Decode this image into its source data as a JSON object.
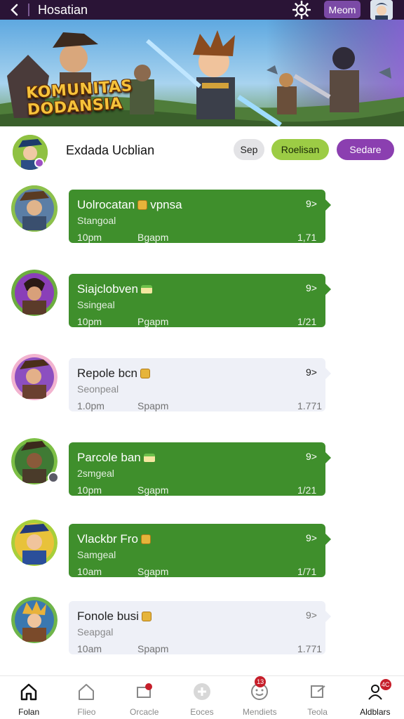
{
  "app": {
    "title": "Hosatian",
    "menu_button_label": "Meom"
  },
  "banner": {
    "title": "KOMUNITAS DODANSIA"
  },
  "header": {
    "name": "Exdada Ucblian",
    "buttons": [
      "Sep",
      "Roelisan",
      "Sedare"
    ],
    "colors": {
      "sep": "#e3e3e6",
      "roelisan": "#9ccc45",
      "sedare": "#8b3fb0"
    }
  },
  "messages": [
    {
      "name": "Uolrocatan",
      "suffix": "vpnsa",
      "emoji": "coin",
      "count": "9>",
      "subtitle": "Stangoal",
      "time": "10pm",
      "tag": "Bgapm",
      "number": "1,71",
      "style": "green"
    },
    {
      "name": "Siajclobven",
      "suffix": "",
      "emoji": "cake",
      "count": "9>",
      "subtitle": "Ssingeal",
      "time": "10pm",
      "tag": "Pgapm",
      "number": "1/21",
      "style": "green"
    },
    {
      "name": "Repole bcn",
      "suffix": "",
      "emoji": "coin",
      "count": "9>",
      "subtitle": "Seonpeal",
      "time": "1.0pm",
      "tag": "Spapm",
      "number": "1.771",
      "style": "light"
    },
    {
      "name": "Parcole ban",
      "suffix": "",
      "emoji": "cake",
      "count": "9>",
      "subtitle": "2smgeal",
      "time": "10pm",
      "tag": "Sgapm",
      "number": "1/21",
      "style": "green"
    },
    {
      "name": "Vlackbr Fro",
      "suffix": "",
      "emoji": "coin",
      "count": "9>",
      "subtitle": "Samgeal",
      "time": "10am",
      "tag": "Sgapm",
      "number": "1/71",
      "style": "green"
    },
    {
      "name": "Fonole busi",
      "suffix": "",
      "emoji": "coin",
      "count": "9>",
      "subtitle": "Seapgal",
      "time": "10am",
      "tag": "Spapm",
      "number": "1.771",
      "style": "light"
    }
  ],
  "bottom_nav": [
    {
      "label": "Folan",
      "icon": "home-icon",
      "badge": ""
    },
    {
      "label": "Flieo",
      "icon": "house-outline-icon",
      "badge": ""
    },
    {
      "label": "Orcacle",
      "icon": "chat-icon",
      "badge": ""
    },
    {
      "label": "Eoces",
      "icon": "sticker-icon",
      "badge": ""
    },
    {
      "label": "Mendiets",
      "icon": "smile-icon",
      "badge": "13"
    },
    {
      "label": "Teola",
      "icon": "share-icon",
      "badge": ""
    },
    {
      "label": "Aldblars",
      "icon": "profile-icon",
      "badge": "4C"
    }
  ],
  "colors": {
    "topbar": "#2a1436",
    "bubble_green": "#3f8f2c",
    "bubble_light": "#eef0f7",
    "accent_purple": "#8b3fb0"
  }
}
